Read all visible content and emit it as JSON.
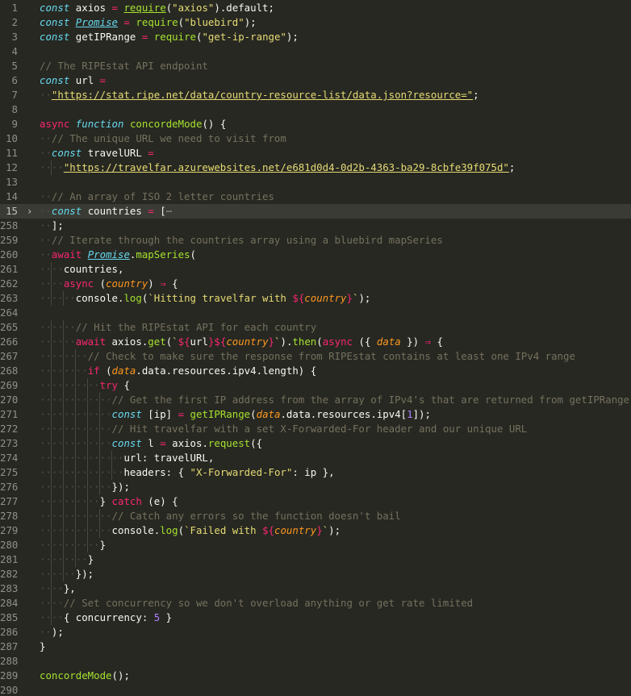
{
  "editor": {
    "language": "javascript",
    "current_line": "15",
    "colors": {
      "background": "#272822",
      "keyword": "#66d9ef",
      "operator": "#f92672",
      "function": "#a6e22e",
      "string": "#e6db74",
      "comment": "#75715e",
      "number": "#ae81ff",
      "parameter": "#fd971f",
      "text": "#f8f8f2"
    },
    "lines": [
      {
        "n": "1",
        "indent": 0,
        "tokens": [
          [
            "kw",
            "const"
          ],
          [
            "t",
            " axios "
          ],
          [
            "op",
            "="
          ],
          [
            "t",
            " "
          ],
          [
            "fnul",
            "require"
          ],
          [
            "t",
            "("
          ],
          [
            "str",
            "\"axios\""
          ],
          [
            "t",
            ").default;"
          ]
        ]
      },
      {
        "n": "2",
        "indent": 0,
        "tokens": [
          [
            "kw",
            "const"
          ],
          [
            "t",
            " "
          ],
          [
            "builtin",
            "Promise"
          ],
          [
            "t",
            " "
          ],
          [
            "op",
            "="
          ],
          [
            "t",
            " "
          ],
          [
            "fn",
            "require"
          ],
          [
            "t",
            "("
          ],
          [
            "str",
            "\"bluebird\""
          ],
          [
            "t",
            ");"
          ]
        ]
      },
      {
        "n": "3",
        "indent": 0,
        "tokens": [
          [
            "kw",
            "const"
          ],
          [
            "t",
            " getIPRange "
          ],
          [
            "op",
            "="
          ],
          [
            "t",
            " "
          ],
          [
            "fn",
            "require"
          ],
          [
            "t",
            "("
          ],
          [
            "str",
            "\"get-ip-range\""
          ],
          [
            "t",
            ");"
          ]
        ]
      },
      {
        "n": "4",
        "indent": 0,
        "tokens": []
      },
      {
        "n": "5",
        "indent": 0,
        "tokens": [
          [
            "cm",
            "// The RIPEstat API endpoint"
          ]
        ]
      },
      {
        "n": "6",
        "indent": 0,
        "tokens": [
          [
            "kw",
            "const"
          ],
          [
            "t",
            " url "
          ],
          [
            "op",
            "="
          ]
        ]
      },
      {
        "n": "7",
        "indent": 1,
        "tokens": [
          [
            "url",
            "\"https://stat.ripe.net/data/country-resource-list/data.json?resource=\""
          ],
          [
            "t",
            ";"
          ]
        ]
      },
      {
        "n": "8",
        "indent": 0,
        "tokens": []
      },
      {
        "n": "9",
        "indent": 0,
        "tokens": [
          [
            "async",
            "async"
          ],
          [
            "t",
            " "
          ],
          [
            "kw",
            "function"
          ],
          [
            "t",
            " "
          ],
          [
            "fn",
            "concordeMode"
          ],
          [
            "t",
            "() {"
          ]
        ]
      },
      {
        "n": "10",
        "indent": 1,
        "tokens": [
          [
            "cm",
            "// The unique URL we need to visit from"
          ]
        ]
      },
      {
        "n": "11",
        "indent": 1,
        "tokens": [
          [
            "kw",
            "const"
          ],
          [
            "t",
            " travelURL "
          ],
          [
            "op",
            "="
          ]
        ]
      },
      {
        "n": "12",
        "indent": 2,
        "tokens": [
          [
            "url",
            "\"https://travelfar.azurewebsites.net/e681d0d4-0d2b-4363-ba29-8cbfe39f075d\""
          ],
          [
            "t",
            ";"
          ]
        ]
      },
      {
        "n": "13",
        "indent": 0,
        "tokens": []
      },
      {
        "n": "14",
        "indent": 1,
        "tokens": [
          [
            "cm",
            "// An array of ISO 2 letter countries"
          ]
        ]
      },
      {
        "n": "15",
        "indent": 1,
        "fold": true,
        "tokens": [
          [
            "kw",
            "const"
          ],
          [
            "t",
            " countries "
          ],
          [
            "op",
            "="
          ],
          [
            "t",
            " ["
          ],
          [
            "fold",
            "⋯"
          ]
        ]
      },
      {
        "n": "258",
        "indent": 1,
        "tokens": [
          [
            "t",
            "];"
          ]
        ]
      },
      {
        "n": "259",
        "indent": 1,
        "tokens": [
          [
            "cm",
            "// Iterate through the countries array using a bluebird mapSeries"
          ]
        ]
      },
      {
        "n": "260",
        "indent": 1,
        "tokens": [
          [
            "async",
            "await"
          ],
          [
            "t",
            " "
          ],
          [
            "builtin",
            "Promise"
          ],
          [
            "t",
            "."
          ],
          [
            "fn",
            "mapSeries"
          ],
          [
            "t",
            "("
          ]
        ]
      },
      {
        "n": "261",
        "indent": 2,
        "tokens": [
          [
            "t",
            "countries,"
          ]
        ]
      },
      {
        "n": "262",
        "indent": 2,
        "tokens": [
          [
            "async",
            "async"
          ],
          [
            "t",
            " ("
          ],
          [
            "param",
            "country"
          ],
          [
            "t",
            ") "
          ],
          [
            "op",
            "⇒"
          ],
          [
            "t",
            " {"
          ]
        ]
      },
      {
        "n": "263",
        "indent": 3,
        "tokens": [
          [
            "t",
            "console."
          ],
          [
            "fn",
            "log"
          ],
          [
            "t",
            "("
          ],
          [
            "str",
            "`Hitting travelfar with "
          ],
          [
            "tpl",
            "${"
          ],
          [
            "param",
            "country"
          ],
          [
            "tpl",
            "}"
          ],
          [
            "str",
            "`"
          ],
          [
            "t",
            ");"
          ]
        ]
      },
      {
        "n": "264",
        "indent": 0,
        "tokens": []
      },
      {
        "n": "265",
        "indent": 3,
        "tokens": [
          [
            "cm",
            "// Hit the RIPEstat API for each country"
          ]
        ]
      },
      {
        "n": "266",
        "indent": 3,
        "tokens": [
          [
            "async",
            "await"
          ],
          [
            "t",
            " axios."
          ],
          [
            "fn",
            "get"
          ],
          [
            "t",
            "("
          ],
          [
            "str",
            "`"
          ],
          [
            "tpl",
            "${"
          ],
          [
            "t",
            "url"
          ],
          [
            "tpl",
            "}${"
          ],
          [
            "param",
            "country"
          ],
          [
            "tpl",
            "}"
          ],
          [
            "str",
            "`"
          ],
          [
            "t",
            ")."
          ],
          [
            "fn",
            "then"
          ],
          [
            "t",
            "("
          ],
          [
            "async",
            "async"
          ],
          [
            "t",
            " ({ "
          ],
          [
            "param",
            "data"
          ],
          [
            "t",
            " }) "
          ],
          [
            "op",
            "⇒"
          ],
          [
            "t",
            " {"
          ]
        ]
      },
      {
        "n": "267",
        "indent": 4,
        "tokens": [
          [
            "cm",
            "// Check to make sure the response from RIPEstat contains at least one IPv4 range"
          ]
        ]
      },
      {
        "n": "268",
        "indent": 4,
        "tokens": [
          [
            "async",
            "if"
          ],
          [
            "t",
            " ("
          ],
          [
            "param",
            "data"
          ],
          [
            "t",
            ".data.resources.ipv4.length) {"
          ]
        ]
      },
      {
        "n": "269",
        "indent": 5,
        "tokens": [
          [
            "async",
            "try"
          ],
          [
            "t",
            " {"
          ]
        ]
      },
      {
        "n": "270",
        "indent": 6,
        "tokens": [
          [
            "cm",
            "// Get the first IP address from the array of IPv4's that are returned from getIPRange"
          ]
        ]
      },
      {
        "n": "271",
        "indent": 6,
        "tokens": [
          [
            "kw",
            "const"
          ],
          [
            "t",
            " [ip] "
          ],
          [
            "op",
            "="
          ],
          [
            "t",
            " "
          ],
          [
            "fn",
            "getIPRange"
          ],
          [
            "t",
            "("
          ],
          [
            "param",
            "data"
          ],
          [
            "t",
            ".data.resources.ipv4["
          ],
          [
            "num",
            "1"
          ],
          [
            "t",
            "]);"
          ]
        ]
      },
      {
        "n": "272",
        "indent": 6,
        "tokens": [
          [
            "cm",
            "// Hit travelfar with a set X-Forwarded-For header and our unique URL"
          ]
        ]
      },
      {
        "n": "273",
        "indent": 6,
        "tokens": [
          [
            "kw",
            "const"
          ],
          [
            "t",
            " l "
          ],
          [
            "op",
            "="
          ],
          [
            "t",
            " axios."
          ],
          [
            "fn",
            "request"
          ],
          [
            "t",
            "({"
          ]
        ]
      },
      {
        "n": "274",
        "indent": 7,
        "tokens": [
          [
            "t",
            "url: travelURL,"
          ]
        ]
      },
      {
        "n": "275",
        "indent": 7,
        "tokens": [
          [
            "t",
            "headers: { "
          ],
          [
            "str",
            "\"X-Forwarded-For\""
          ],
          [
            "t",
            ": ip },"
          ]
        ]
      },
      {
        "n": "276",
        "indent": 6,
        "tokens": [
          [
            "t",
            "});"
          ]
        ]
      },
      {
        "n": "277",
        "indent": 5,
        "tokens": [
          [
            "t",
            "} "
          ],
          [
            "async",
            "catch"
          ],
          [
            "t",
            " (e) {"
          ]
        ]
      },
      {
        "n": "278",
        "indent": 6,
        "tokens": [
          [
            "cm",
            "// Catch any errors so the function doesn't bail"
          ]
        ]
      },
      {
        "n": "279",
        "indent": 6,
        "tokens": [
          [
            "t",
            "console."
          ],
          [
            "fn",
            "log"
          ],
          [
            "t",
            "("
          ],
          [
            "str",
            "`Failed with "
          ],
          [
            "tpl",
            "${"
          ],
          [
            "param",
            "country"
          ],
          [
            "tpl",
            "}"
          ],
          [
            "str",
            "`"
          ],
          [
            "t",
            ");"
          ]
        ]
      },
      {
        "n": "280",
        "indent": 5,
        "tokens": [
          [
            "t",
            "}"
          ]
        ]
      },
      {
        "n": "281",
        "indent": 4,
        "tokens": [
          [
            "t",
            "}"
          ]
        ]
      },
      {
        "n": "282",
        "indent": 3,
        "tokens": [
          [
            "t",
            "});"
          ]
        ]
      },
      {
        "n": "283",
        "indent": 2,
        "tokens": [
          [
            "t",
            "},"
          ]
        ]
      },
      {
        "n": "284",
        "indent": 2,
        "tokens": [
          [
            "cm",
            "// Set concurrency so we don't overload anything or get rate limited"
          ]
        ]
      },
      {
        "n": "285",
        "indent": 2,
        "tokens": [
          [
            "t",
            "{ concurrency: "
          ],
          [
            "num",
            "5"
          ],
          [
            "t",
            " }"
          ]
        ]
      },
      {
        "n": "286",
        "indent": 1,
        "tokens": [
          [
            "t",
            ");"
          ]
        ]
      },
      {
        "n": "287",
        "indent": 0,
        "tokens": [
          [
            "t",
            "}"
          ]
        ]
      },
      {
        "n": "288",
        "indent": 0,
        "tokens": []
      },
      {
        "n": "289",
        "indent": 0,
        "tokens": [
          [
            "fn",
            "concordeMode"
          ],
          [
            "t",
            "();"
          ]
        ]
      },
      {
        "n": "290",
        "indent": 0,
        "tokens": []
      }
    ]
  }
}
